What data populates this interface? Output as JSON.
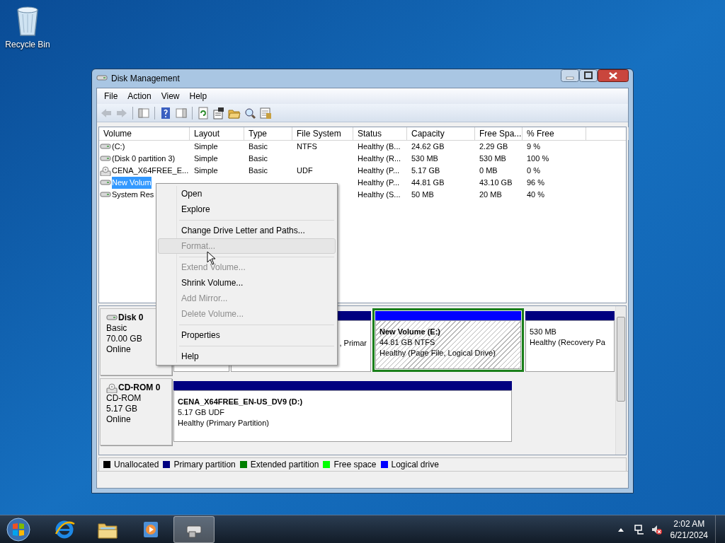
{
  "desktop_icons": [
    {
      "label": "Recycle Bin"
    }
  ],
  "window": {
    "title": "Disk Management"
  },
  "menu_bar": [
    "File",
    "Action",
    "View",
    "Help"
  ],
  "table": {
    "columns": [
      "Volume",
      "Layout",
      "Type",
      "File System",
      "Status",
      "Capacity",
      "Free Spa...",
      "% Free"
    ],
    "rows": [
      {
        "kind": "disk",
        "selected": false,
        "cells": [
          "(C:)",
          "Simple",
          "Basic",
          "NTFS",
          "Healthy (B...",
          "24.62 GB",
          "2.29 GB",
          "9 %"
        ]
      },
      {
        "kind": "disk",
        "selected": false,
        "cells": [
          "(Disk 0 partition 3)",
          "Simple",
          "Basic",
          null,
          "Healthy (R...",
          "530 MB",
          "530 MB",
          "100 %"
        ]
      },
      {
        "kind": "cdrom",
        "selected": false,
        "cells": [
          "CENA_X64FREE_E...",
          "Simple",
          "Basic",
          "UDF",
          "Healthy (P...",
          "5.17 GB",
          "0 MB",
          "0 %"
        ]
      },
      {
        "kind": "disk",
        "selected": true,
        "cells": [
          "New Volum",
          null,
          null,
          null,
          "Healthy (P...",
          "44.81 GB",
          "43.10 GB",
          "96 %"
        ]
      },
      {
        "kind": "disk",
        "selected": false,
        "cells": [
          "System Res",
          null,
          null,
          null,
          "Healthy (S...",
          "50 MB",
          "20 MB",
          "40 %"
        ]
      }
    ]
  },
  "context_menu": [
    {
      "kind": "item",
      "label": "Open",
      "disabled": false,
      "highlighted": false
    },
    {
      "kind": "item",
      "label": "Explore",
      "disabled": false,
      "highlighted": false
    },
    {
      "kind": "separator"
    },
    {
      "kind": "item",
      "label": "Change Drive Letter and Paths...",
      "disabled": false,
      "highlighted": false
    },
    {
      "kind": "item",
      "label": "Format...",
      "disabled": true,
      "highlighted": true
    },
    {
      "kind": "separator"
    },
    {
      "kind": "item",
      "label": "Extend Volume...",
      "disabled": true,
      "highlighted": false
    },
    {
      "kind": "item",
      "label": "Shrink Volume...",
      "disabled": false,
      "highlighted": false
    },
    {
      "kind": "item",
      "label": "Add Mirror...",
      "disabled": true,
      "highlighted": false
    },
    {
      "kind": "item",
      "label": "Delete Volume...",
      "disabled": true,
      "highlighted": false
    },
    {
      "kind": "separator"
    },
    {
      "kind": "item",
      "label": "Properties",
      "disabled": false,
      "highlighted": false
    },
    {
      "kind": "separator"
    },
    {
      "kind": "item",
      "label": "Help",
      "disabled": false,
      "highlighted": false
    }
  ],
  "disks": [
    {
      "kind": "disk",
      "name": "Disk 0",
      "type": "Basic",
      "size": "70.00 GB",
      "status": "Online",
      "partitions": [
        {
          "kind": "primary",
          "selected": false
        },
        {
          "kind": "primary",
          "selected": false,
          "lines": [
            ", Primar"
          ]
        },
        {
          "kind": "logical",
          "selected": true,
          "title": "New Volume  (E:)",
          "lines": [
            "44.81 GB NTFS",
            "Healthy (Page File, Logical Drive)"
          ]
        },
        {
          "kind": "primary",
          "selected": false,
          "lines": [
            "530 MB",
            "Healthy (Recovery Pa"
          ]
        }
      ]
    },
    {
      "kind": "cdrom",
      "name": "CD-ROM 0",
      "type": "CD-ROM",
      "size": "5.17 GB",
      "status": "Online",
      "partitions": [
        {
          "kind": "primary",
          "selected": false,
          "title": "CENA_X64FREE_EN-US_DV9  (D:)",
          "lines": [
            "5.17 GB UDF",
            "Healthy (Primary Partition)"
          ]
        }
      ]
    }
  ],
  "legend": [
    {
      "label": "Unallocated",
      "color": "#000000"
    },
    {
      "label": "Primary partition",
      "color": "#000080"
    },
    {
      "label": "Extended partition",
      "color": "#008000"
    },
    {
      "label": "Free space",
      "color": "#00ff00"
    },
    {
      "label": "Logical drive",
      "color": "#0000ff"
    }
  ],
  "taskbar": {
    "items": [
      {
        "kind": "browser",
        "selected": false
      },
      {
        "kind": "folder",
        "selected": false
      },
      {
        "kind": "player",
        "selected": false
      },
      {
        "kind": "disk",
        "selected": true
      }
    ],
    "time": "2:02 AM",
    "date": "6/21/2024"
  }
}
